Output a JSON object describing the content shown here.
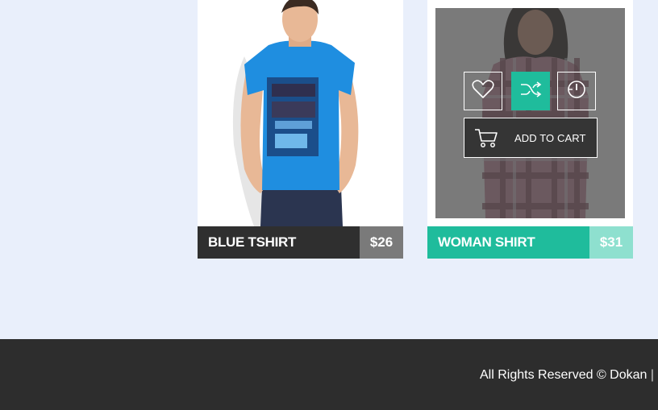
{
  "products": [
    {
      "name": "BLUE TSHIRT",
      "price": "$26"
    },
    {
      "name": "WOMAN SHIRT",
      "price": "$31"
    }
  ],
  "hover_actions": {
    "wishlist_icon": "heart-icon",
    "compare_icon": "shuffle-icon",
    "quick_view_icon": "clock-icon",
    "add_to_cart_label": "ADD TO CART",
    "cart_icon": "cart-icon"
  },
  "footer": {
    "copyright": "All Rights Reserved © Dokan",
    "separator": "|"
  },
  "colors": {
    "accent": "#1fbc9c",
    "dark": "#2f2f2f",
    "background": "#e9effb"
  }
}
